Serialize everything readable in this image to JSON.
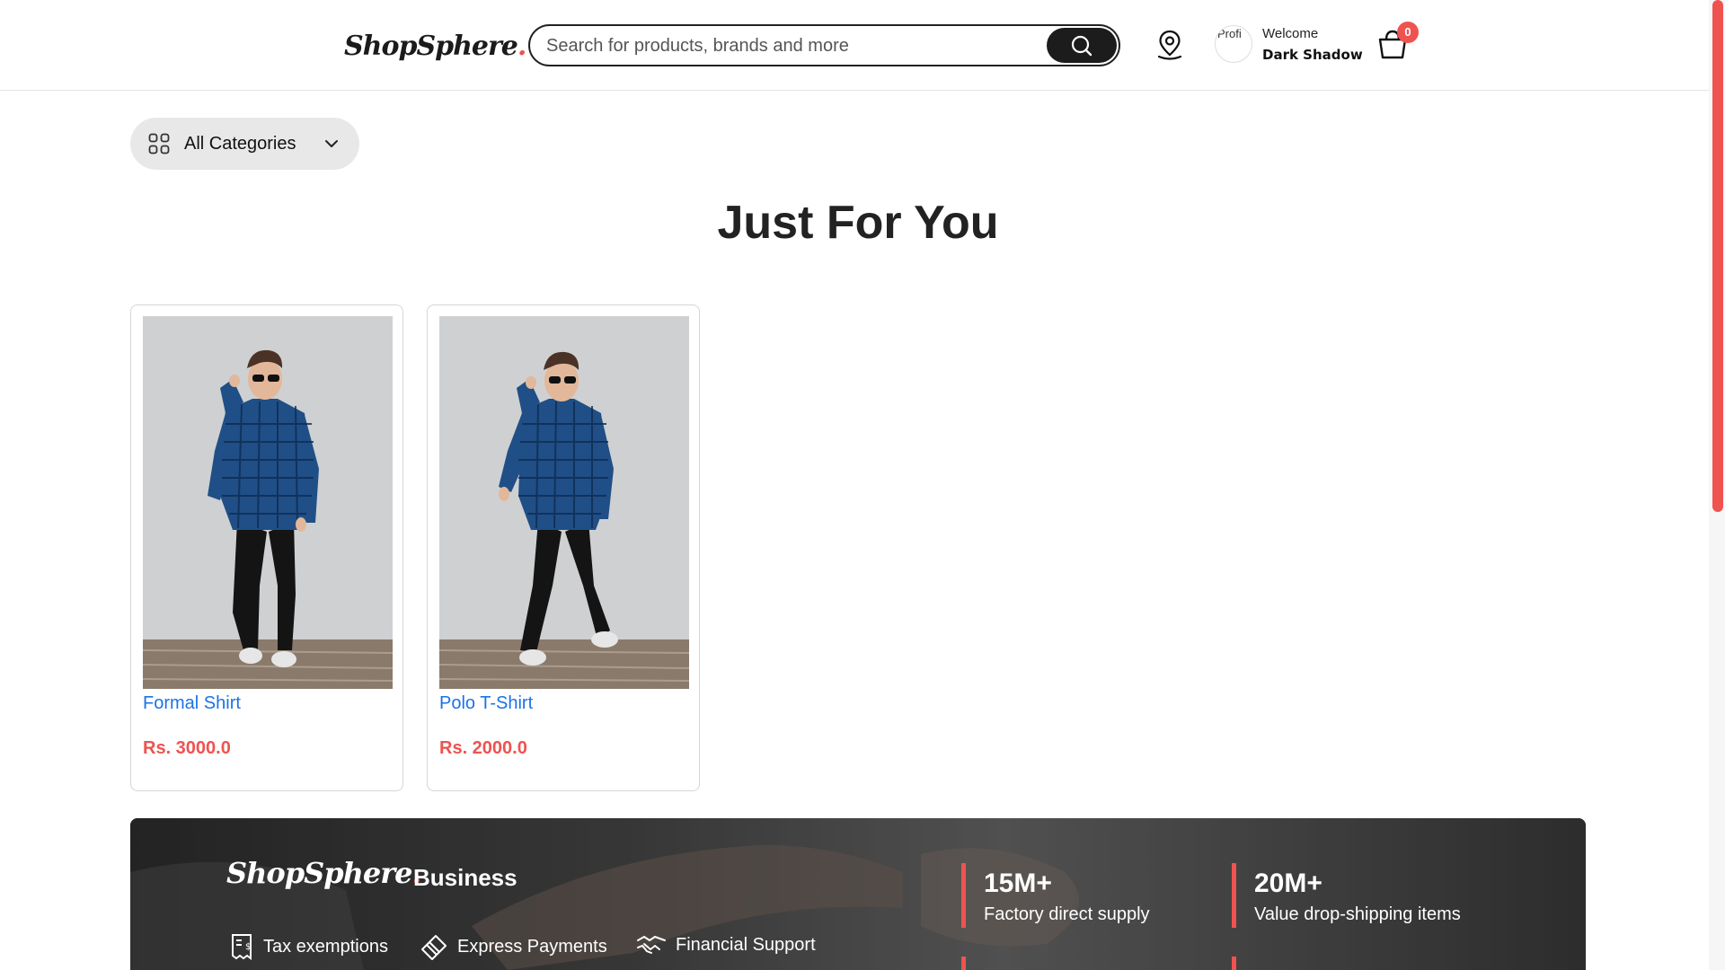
{
  "header": {
    "logo_text": "ShopSphere",
    "logo_dot": ".",
    "search_placeholder": "Search for products, brands and more",
    "avatar_alt": "Profile",
    "avatar_broken_text": "Profi",
    "welcome": "Welcome",
    "username": "Dark Shadow",
    "cart_count": "0"
  },
  "categories": {
    "label": "All Categories"
  },
  "section": {
    "title": "Just For You"
  },
  "products": [
    {
      "name": "Formal Shirt",
      "price": "Rs. 3000.0"
    },
    {
      "name": "Polo T-Shirt",
      "price": "Rs. 2000.0"
    }
  ],
  "banner": {
    "logo_text": "ShopSphere",
    "logo_dot": ".",
    "business": "Business",
    "features": [
      "Tax exemptions",
      "Express Payments",
      "Financial Support"
    ],
    "stats": [
      {
        "num": "15M+",
        "text": "Factory direct supply"
      },
      {
        "num": "20M+",
        "text": "Value drop-shipping items"
      }
    ]
  },
  "colors": {
    "accent": "#ef5350",
    "link": "#1a73e8",
    "dark": "#1c1c1c",
    "category_bg": "#e8e8e8"
  },
  "icons": [
    "search-icon",
    "location-icon",
    "cart-icon",
    "grid-icon",
    "chevron-down-icon",
    "receipt-icon",
    "card-icon",
    "handshake-icon"
  ]
}
